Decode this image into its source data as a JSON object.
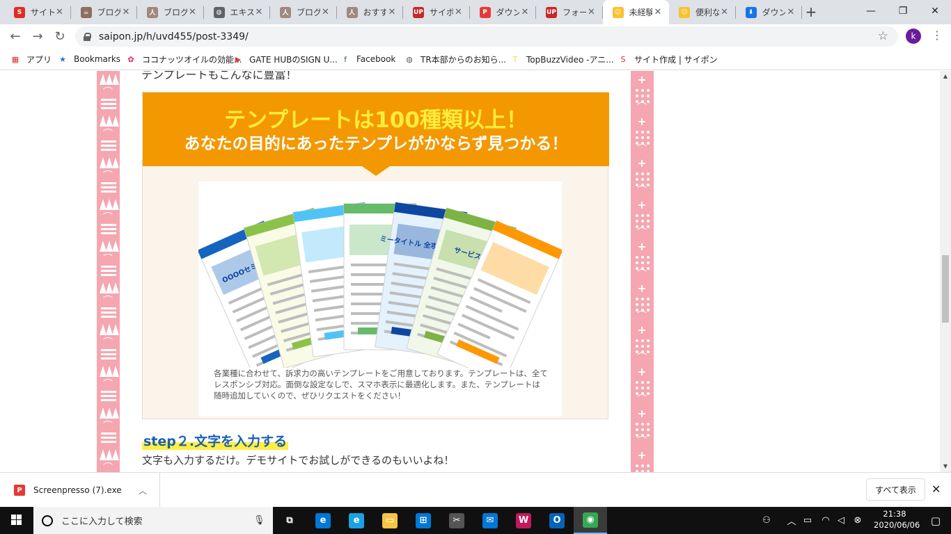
{
  "browser": {
    "tabs": [
      {
        "title": "サイト作成",
        "active": false,
        "favicon_color": "#d93025",
        "favicon_glyph": "S"
      },
      {
        "title": "ブログ",
        "active": false,
        "favicon_color": "#8d6e63",
        "favicon_glyph": "☕"
      },
      {
        "title": "ブログ",
        "active": false,
        "favicon_color": "#a1887f",
        "favicon_glyph": "人"
      },
      {
        "title": "エキスパート",
        "active": false,
        "favicon_color": "#5f6368",
        "favicon_glyph": "◍"
      },
      {
        "title": "ブログ",
        "active": false,
        "favicon_color": "#a1887f",
        "favicon_glyph": "人"
      },
      {
        "title": "おすすめ",
        "active": false,
        "favicon_color": "#a1887f",
        "favicon_glyph": "人"
      },
      {
        "title": "サイポン",
        "active": false,
        "favicon_color": "#c62828",
        "favicon_glyph": "UP"
      },
      {
        "title": "ダウンロード",
        "active": false,
        "favicon_color": "#e53935",
        "favicon_glyph": "P"
      },
      {
        "title": "フォーマット",
        "active": false,
        "favicon_color": "#c62828",
        "favicon_glyph": "UP"
      },
      {
        "title": "未経験",
        "active": true,
        "favicon_color": "#fbc02d",
        "favicon_glyph": "☺"
      },
      {
        "title": "便利な",
        "active": false,
        "favicon_color": "#fbc02d",
        "favicon_glyph": "☺"
      },
      {
        "title": "ダウンロード",
        "active": false,
        "favicon_color": "#1a73e8",
        "favicon_glyph": "⬇"
      }
    ],
    "new_tab": "+",
    "window_controls": {
      "minimize": "—",
      "maximize": "❐",
      "close": "✕"
    },
    "nav": {
      "back": "←",
      "forward": "→",
      "reload": "↻"
    },
    "url": "saipon.jp/h/uvd455/post-3349/",
    "star": "☆",
    "avatar_letter": "k",
    "menu": "⋮",
    "bookmarks": [
      {
        "label": "アプリ",
        "icon": "apps-grid-icon",
        "glyph": "▦",
        "color": "#d93025"
      },
      {
        "label": "Bookmarks",
        "icon": "star-icon",
        "glyph": "★",
        "color": "#1a73e8"
      },
      {
        "label": "ココナッツオイルの効能...",
        "icon": "page-icon",
        "glyph": "✿",
        "color": "#e91e63"
      },
      {
        "label": "GATE HUBのSIGN U...",
        "icon": "youtube-icon",
        "glyph": "▶",
        "color": "#e53935"
      },
      {
        "label": "Facebook",
        "icon": "facebook-icon",
        "glyph": "f",
        "color": "#3b5998"
      },
      {
        "label": "TR本部からのお知ら...",
        "icon": "globe-icon",
        "glyph": "◍",
        "color": "#5f6368"
      },
      {
        "label": "TopBuzzVideo -アニ...",
        "icon": "topbuzz-icon",
        "glyph": "T",
        "color": "#fdd835"
      },
      {
        "label": "サイト作成 | サイポン",
        "icon": "saipon-icon",
        "glyph": "S",
        "color": "#d93025"
      }
    ]
  },
  "page": {
    "top_line": "テンプレートもこんなに豊富！",
    "banner": {
      "headline": "テンプレートは100種類以上！",
      "subheadline": "あなたの目的にあったテンプレがかならず見つかる！",
      "description": "各業種に合わせて、訴求力の高いテンプレートをご用意しております。テンプレートは、全てレスポンシブ対応。面倒な設定なしで、スマホ表示に最適化します。また、テンプレートは随時追加していくので、ぜひリクエストをください！",
      "cards": [
        {
          "title": "OOOOセミナー",
          "accent": "#1565c0",
          "color": "#ffffff"
        },
        {
          "title": "",
          "accent": "#8bc34a",
          "color": "#f9fbe7"
        },
        {
          "title": "",
          "accent": "#4fc3f7",
          "color": "#ffffff"
        },
        {
          "title": "",
          "accent": "#66bb6a",
          "color": "#ffffff"
        },
        {
          "title": "ミータイトル 全攻略バイブル",
          "accent": "#0d47a1",
          "color": "#e3f2fd"
        },
        {
          "title": "サービス名",
          "accent": "#7cb342",
          "color": "#f1f8e9"
        },
        {
          "title": "",
          "accent": "#ff9800",
          "color": "#ffffff"
        }
      ]
    },
    "step_heading": "step２.文字を入力する",
    "step_text": "文字も入力するだけ。デモサイトでお試しができるのもいいよね！"
  },
  "download_shelf": {
    "file": "Screenpresso (7).exe",
    "show_all": "すべて表示",
    "close": "✕"
  },
  "taskbar": {
    "search_placeholder": "ここに入力して検索",
    "apps": [
      {
        "name": "task-view",
        "glyph": "⧉",
        "color": "#101010"
      },
      {
        "name": "edge",
        "glyph": "e",
        "color": "#0078d7"
      },
      {
        "name": "internet-explorer",
        "glyph": "e",
        "color": "#1ba1e2"
      },
      {
        "name": "file-explorer",
        "glyph": "▭",
        "color": "#f4c542"
      },
      {
        "name": "store",
        "glyph": "⊞",
        "color": "#0078d7"
      },
      {
        "name": "snipping",
        "glyph": "✂",
        "color": "#555555"
      },
      {
        "name": "mail",
        "glyph": "✉",
        "color": "#0078d7"
      },
      {
        "name": "wondershare",
        "glyph": "W",
        "color": "#c2185b"
      },
      {
        "name": "outlook",
        "glyph": "O",
        "color": "#0364b8"
      },
      {
        "name": "chrome",
        "glyph": "◉",
        "color": "#34a853"
      }
    ],
    "time": "21:38",
    "date": "2020/06/06"
  },
  "colors": {
    "accent_orange": "#f39800",
    "headline_yellow": "#ffec3d",
    "pink_border": "#f5a6b0",
    "step_blue": "#1a5fb4",
    "highlight_yellow": "#ffef40"
  }
}
